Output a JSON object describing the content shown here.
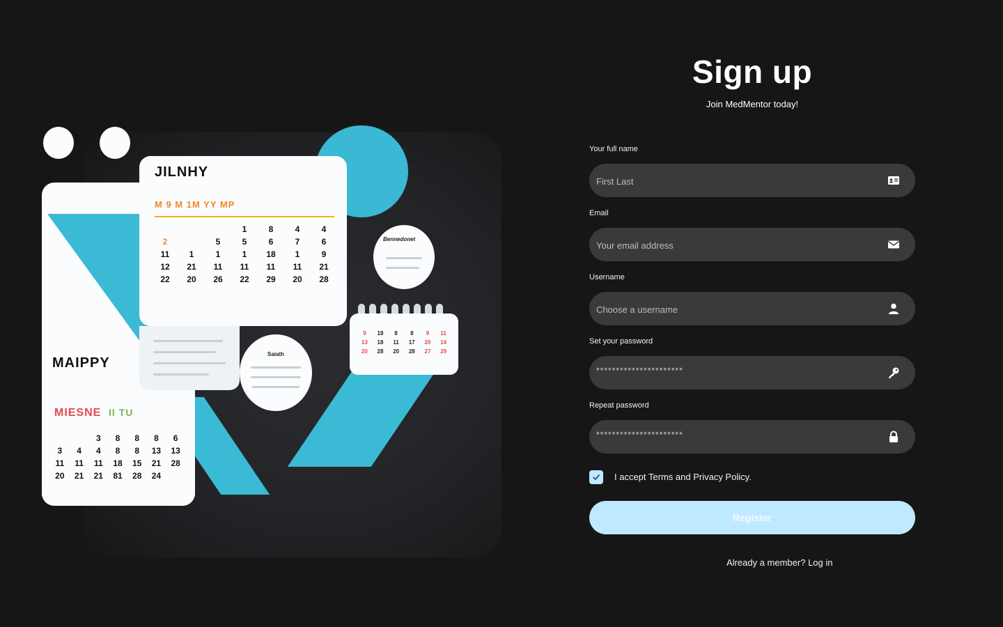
{
  "form": {
    "title": "Sign up",
    "subtitle": "Join MedMentor today!",
    "fields": [
      {
        "label": "Your full name",
        "placeholder": "First Last",
        "value": "",
        "icon": "id-card-icon"
      },
      {
        "label": "Email",
        "placeholder": "Your email address",
        "value": "",
        "icon": "envelope-icon"
      },
      {
        "label": "Username",
        "placeholder": "Choose a username",
        "value": "",
        "icon": "user-icon"
      },
      {
        "label": "Set your password",
        "placeholder": "",
        "value": "**********************",
        "icon": "key-icon"
      },
      {
        "label": "Repeat password",
        "placeholder": "",
        "value": "**********************",
        "icon": "lock-icon"
      }
    ],
    "terms": {
      "checked": true,
      "label": "I accept Terms and Privacy Policy."
    },
    "register_label": "Register",
    "login_prompt": "Already a member?",
    "login_link": "Log in"
  },
  "illustration": {
    "large_card_title": "MAIPPY",
    "large_card_sub": "MIESNE",
    "large_card_days": "II TU",
    "large_card_numbers": [
      "",
      "",
      "3",
      "8",
      "8",
      "8",
      "6",
      "3",
      "4",
      "4",
      "8",
      "8",
      "13",
      "13",
      "11",
      "11",
      "11",
      "18",
      "15",
      "21",
      "28",
      "20",
      "21",
      "21",
      "81",
      "28",
      "24",
      ""
    ],
    "main_card_title": "JILNHY",
    "main_card_header": "M 9 M 1M YY MP",
    "main_card_numbers": [
      "",
      "",
      "",
      "1",
      "8",
      "4",
      "4",
      "2",
      "",
      "5",
      "5",
      "6",
      "7",
      "6",
      "11",
      "1",
      "1",
      "1",
      "18",
      "1",
      "9",
      "12",
      "21",
      "11",
      "11",
      "11",
      "11",
      "21",
      "22",
      "20",
      "26",
      "22",
      "29",
      "20",
      "28"
    ],
    "circle_label": "Saiath",
    "circle_label_2": "Bennedonet",
    "right_card_numbers": [
      "9",
      "18",
      "8",
      "8",
      "9",
      "11",
      "13",
      "18",
      "11",
      "17",
      "20",
      "14",
      "20",
      "28",
      "20",
      "28",
      "27",
      "29"
    ],
    "colors": {
      "accent_blue": "#3bbad6",
      "orange": "#f08a24",
      "red": "#e24b4b",
      "green": "#7bb84a"
    }
  },
  "colors": {
    "background": "#161617",
    "field_bg": "#3a3a3b",
    "button_bg": "#bfe9ff",
    "checkbox_bg": "#bfe9ff"
  }
}
